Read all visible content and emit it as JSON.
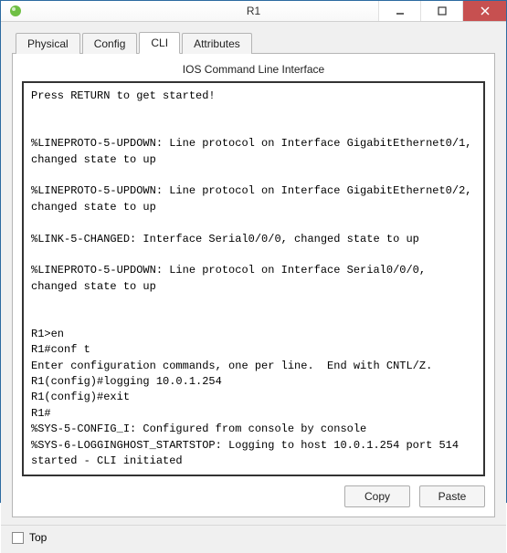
{
  "window": {
    "title": "R1"
  },
  "tabs": {
    "items": [
      {
        "label": "Physical",
        "active": false
      },
      {
        "label": "Config",
        "active": false
      },
      {
        "label": "CLI",
        "active": true
      },
      {
        "label": "Attributes",
        "active": false
      }
    ]
  },
  "panel": {
    "title": "IOS Command Line Interface"
  },
  "terminal": {
    "text": "Press RETURN to get started!\n\n\n%LINEPROTO-5-UPDOWN: Line protocol on Interface GigabitEthernet0/1, changed state to up\n\n%LINEPROTO-5-UPDOWN: Line protocol on Interface GigabitEthernet0/2, changed state to up\n\n%LINK-5-CHANGED: Interface Serial0/0/0, changed state to up\n\n%LINEPROTO-5-UPDOWN: Line protocol on Interface Serial0/0/0, changed state to up\n\n\nR1>en\nR1#conf t\nEnter configuration commands, one per line.  End with CNTL/Z.\nR1(config)#logging 10.0.1.254\nR1(config)#exit\nR1#\n%SYS-5-CONFIG_I: Configured from console by console\n%SYS-6-LOGGINGHOST_STARTSTOP: Logging to host 10.0.1.254 port 514 started - CLI initiated"
  },
  "buttons": {
    "copy": "Copy",
    "paste": "Paste"
  },
  "footer": {
    "top_label": "Top",
    "top_checked": false
  }
}
